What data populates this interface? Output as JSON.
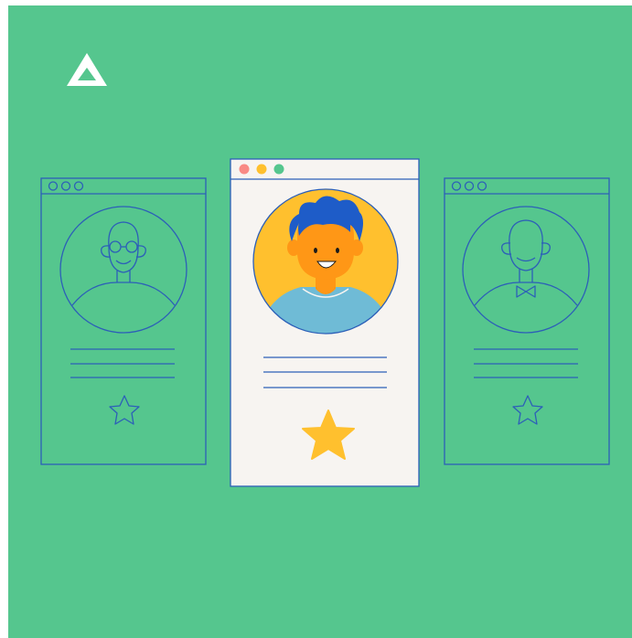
{
  "colors": {
    "background": "#55C68E",
    "outline": "#2C5FB8",
    "card_fill": "#F7F4F1",
    "avatar_yellow": "#FFC02E",
    "skin_orange": "#FF9716",
    "hair_blue": "#1E5CC8",
    "shirt_blue": "#6FBBD6",
    "star_yellow": "#FFC02E",
    "dot_red": "#F98A85",
    "dot_yellow": "#FFC02E",
    "dot_green": "#55C68E",
    "logo_white": "#FFFFFF"
  },
  "icons": {
    "logo": "triangle-logo-icon",
    "left_star": "star-outline-icon",
    "center_star": "star-filled-icon",
    "right_star": "star-outline-icon"
  }
}
